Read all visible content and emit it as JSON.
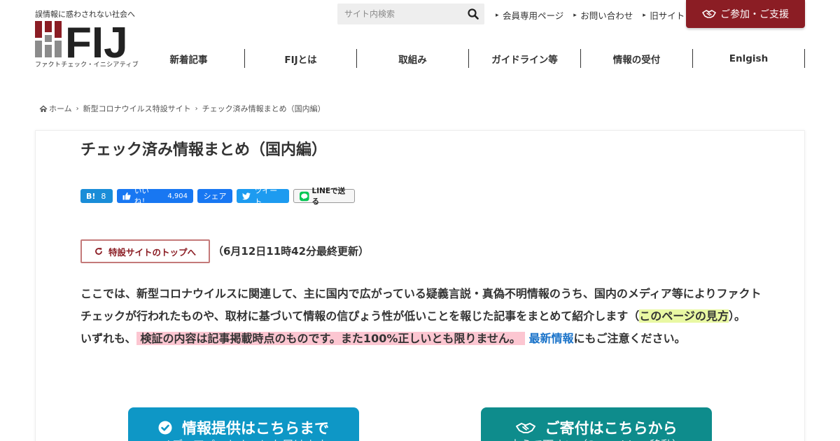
{
  "header": {
    "tagline": "誤情報に惑わされない社会へ",
    "logo_text": "FIJ",
    "logo_subtitle": "ファクトチェック・イニシアティブ",
    "search_placeholder": "サイト内検索",
    "top_links": [
      "会員専用ページ",
      "お問い合わせ",
      "旧サイト"
    ],
    "support_button": "ご参加・ご支援"
  },
  "nav": {
    "items": [
      "新着記事",
      "FIJとは",
      "取組み",
      "ガイドライン等",
      "情報の受付",
      "Enlgish"
    ]
  },
  "breadcrumb": {
    "home": "ホーム",
    "items": [
      "新型コロナウイルス特設サイト",
      "チェック済み情報まとめ（国内編）"
    ]
  },
  "article": {
    "title": "チェック済み情報まとめ（国内編）",
    "share": {
      "hatena_label": "B!",
      "hatena_count": "8",
      "like_label": "いいね！",
      "like_count": "4,904",
      "share_label": "シェア",
      "tweet_label": "ツイート",
      "line_label": "LINEで送る"
    },
    "top_button": "特設サイトのトップへ",
    "updated": "（6月12日11時42分最終更新）",
    "paragraph1_pre": "ここでは、新型コロナウイルスに関連して、主に国内で広がっている疑義言説・真偽不明情報のうち、国内のメディア等によりファクトチェックが行われたものや、取材に基づいて情報の信ぴょう性が低いことを報じた記事をまとめて紹介します（",
    "paragraph1_link": "このページの見方",
    "paragraph1_post": "）。",
    "paragraph2_pre": "いずれも、",
    "paragraph2_highlight": "検証の内容は記事掲載時点のものです。また100%正しいとも限りません。",
    "paragraph2_link": "最新情報",
    "paragraph2_post": "にもご注意ください。"
  },
  "cta": {
    "info_main": "情報提供はこちらまで",
    "info_sub": "メディアパートナーにも届けます",
    "donate_main": "ご寄付はこちらから",
    "donate_sub": "支えて下さい（Syncableへ移動）"
  },
  "colors": {
    "brand": "#8b1d24",
    "info_cta": "#0e97c6",
    "donate_cta": "#0e8c8c",
    "highlight_green": "#e9f8a3",
    "highlight_pink": "#fcc6d1",
    "link": "#1a73c9"
  }
}
